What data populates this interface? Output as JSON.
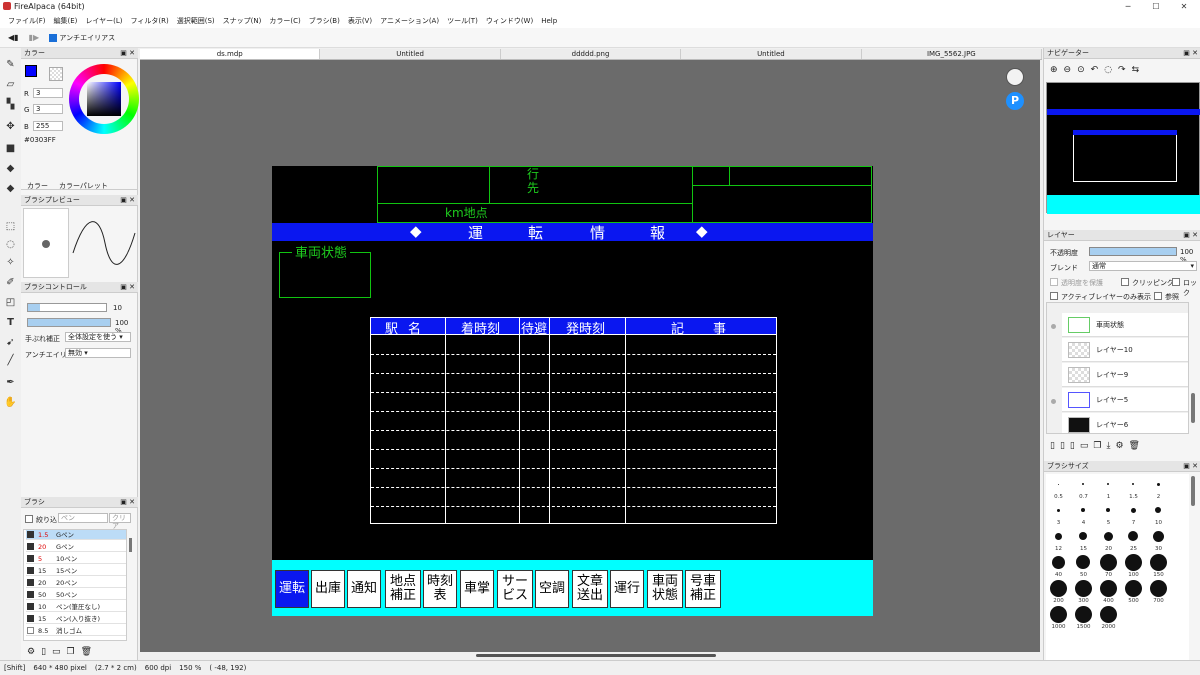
{
  "window": {
    "title": "FireAlpaca (64bit)",
    "minimize": "─",
    "maximize": "☐",
    "close": "✕"
  },
  "menu": [
    "ファイル(F)",
    "編集(E)",
    "レイヤー(L)",
    "フィルタ(R)",
    "選択範囲(S)",
    "スナップ(N)",
    "カラー(C)",
    "ブラシ(B)",
    "表示(V)",
    "アニメーション(A)",
    "ツール(T)",
    "ウィンドウ(W)",
    "Help"
  ],
  "toolbar": {
    "antialias": "アンチエイリアス"
  },
  "doc_tabs": [
    "ds.mdp",
    "Untitled",
    "ddddd.png",
    "Untitled",
    "IMG_5562.JPG"
  ],
  "color_panel": {
    "title": "カラー",
    "r_label": "R",
    "r": "3",
    "g_label": "G",
    "g": "3",
    "b_label": "B",
    "b": "255",
    "hex": "#0303FF",
    "tab_color": "カラー",
    "tab_palette": "カラーパレット"
  },
  "brush_preview": {
    "title": "ブラシプレビュー"
  },
  "brush_control": {
    "title": "ブラシコントロール",
    "size": "10",
    "opacity": "100 %",
    "stabilizer_label": "手ぶれ補正",
    "stabilizer": "全体設定を使う",
    "aa_label": "アンチエイリアス",
    "aa": "無効"
  },
  "brush_panel": {
    "title": "ブラシ",
    "filter_label": "絞り込",
    "filter_placeholder": "ペン",
    "clear": "クリア",
    "items": [
      {
        "size": "1.5",
        "name": "Gペン"
      },
      {
        "size": "20",
        "name": "Gペン"
      },
      {
        "size": "5",
        "name": "10ペン"
      },
      {
        "size": "15",
        "name": "15ペン"
      },
      {
        "size": "20",
        "name": "20ペン"
      },
      {
        "size": "50",
        "name": "50ペン"
      },
      {
        "size": "10",
        "name": "ペン(筆圧なし)"
      },
      {
        "size": "15",
        "name": "ペン(入り抜き)"
      },
      {
        "size": "8.5",
        "name": "消しゴム"
      }
    ]
  },
  "navigator": {
    "title": "ナビゲーター"
  },
  "layer_panel": {
    "title": "レイヤー",
    "opacity_label": "不透明度",
    "opacity": "100 %",
    "blend_label": "ブレンド",
    "blend": "通常",
    "protect": "透明度を保護",
    "clipping": "クリッピング",
    "lock": "ロック",
    "active_only": "アクティブレイヤーのみ表示",
    "reference": "参照",
    "layers": [
      "車両状態",
      "レイヤー10",
      "レイヤー9",
      "レイヤー5",
      "レイヤー6"
    ]
  },
  "brush_size": {
    "title": "ブラシサイズ",
    "sizes": [
      "0.5",
      "0.7",
      "1",
      "1.5",
      "2",
      "3",
      "4",
      "5",
      "7",
      "10",
      "12",
      "15",
      "20",
      "25",
      "30",
      "40",
      "50",
      "70",
      "100",
      "150",
      "200",
      "300",
      "400",
      "500",
      "700",
      "1000",
      "1500",
      "2000"
    ]
  },
  "status": {
    "shift": "[Shift]",
    "size": "640 * 480 pixel",
    "cm": "(2.7 * 2 cm)",
    "dpi": "600 dpi",
    "zoom": "150 %",
    "coords": "( -48, 192)"
  },
  "document": {
    "top_label_1": "行先",
    "top_label_2": "km地点",
    "banner": [
      "◆",
      "運",
      "転",
      "情",
      "報",
      "◆"
    ],
    "vehicle_state": "車両状態",
    "table_headers": [
      "駅名",
      "着時刻",
      "待避",
      "発時刻",
      "記　事"
    ],
    "buttons": [
      "運転",
      "出庫",
      "通知",
      "地点補正",
      "時刻表",
      "車掌",
      "サービス",
      "空調",
      "文章送出",
      "運行",
      "車両状態",
      "号車補正"
    ]
  },
  "colors": {
    "accent_blue": "#0a17f0",
    "green_line": "#11c411",
    "cyan": "#00ffff",
    "swatch": "#0303FF"
  }
}
